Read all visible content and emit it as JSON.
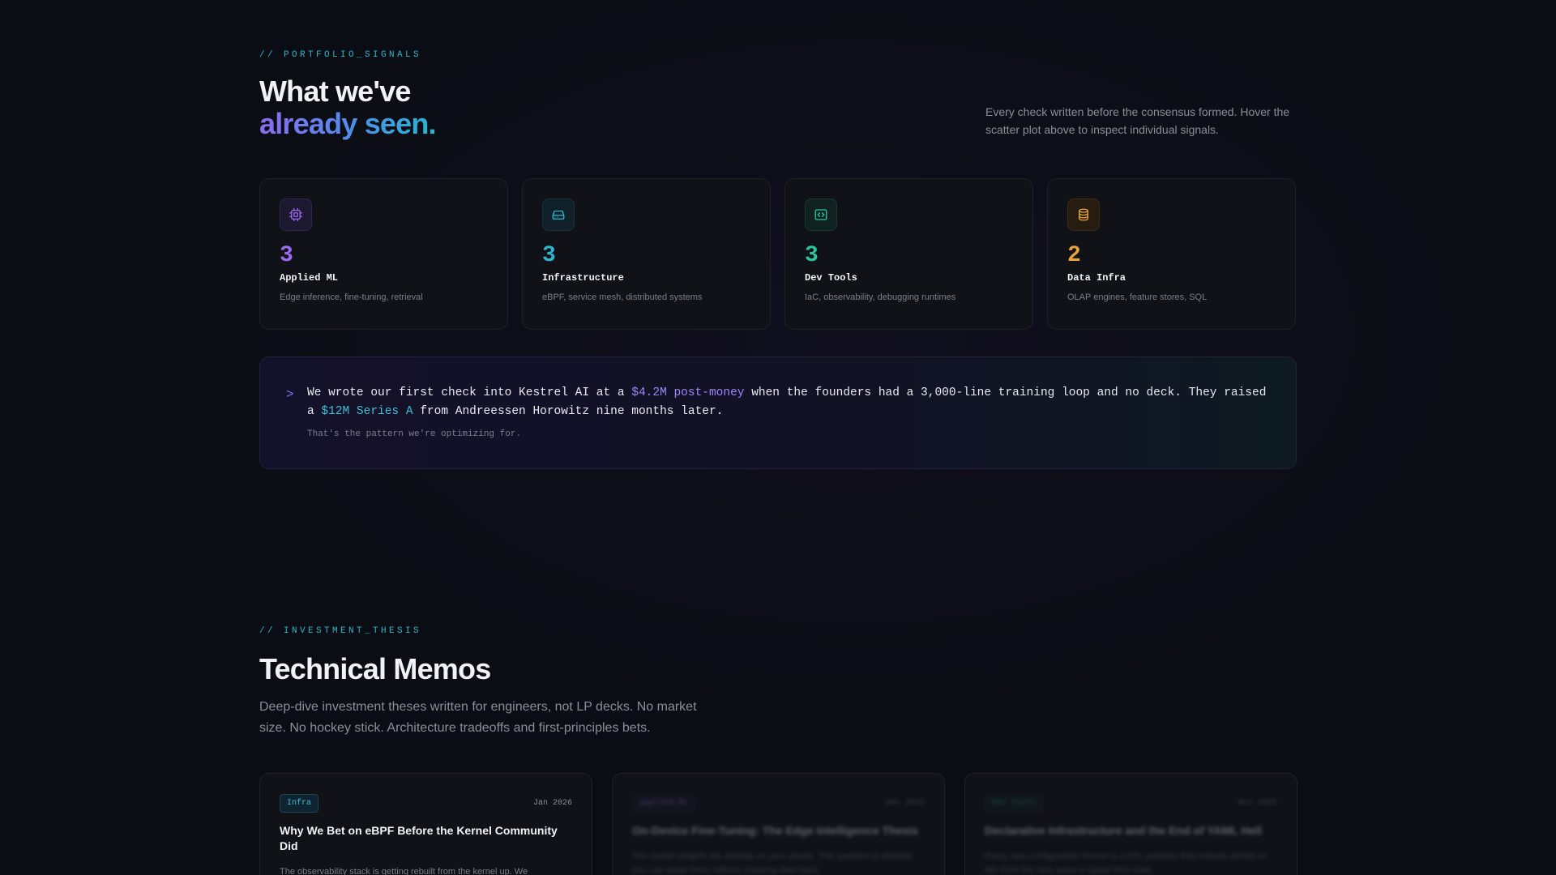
{
  "portfolio": {
    "eyebrow": "// PORTFOLIO_SIGNALS",
    "title_line1": "What we've",
    "title_line2": "already seen.",
    "side_note": "Every check written before the consensus formed. Hover the scatter plot above to inspect individual signals.",
    "stats": [
      {
        "icon": "cpu-chip-icon",
        "count": "3",
        "title": "Applied ML",
        "desc": "Edge inference, fine-tuning, retrieval",
        "color": "#9b6bf2",
        "bg": "#1c1830",
        "border": "#2e2650"
      },
      {
        "icon": "hard-drive-icon",
        "count": "3",
        "title": "Infrastructure",
        "desc": "eBPF, service mesh, distributed systems",
        "color": "#2fb6cf",
        "bg": "#0f2029",
        "border": "#173340"
      },
      {
        "icon": "code-brackets-icon",
        "count": "3",
        "title": "Dev Tools",
        "desc": "IaC, observability, debugging runtimes",
        "color": "#2fc4a0",
        "bg": "#0f2220",
        "border": "#173833"
      },
      {
        "icon": "database-icon",
        "count": "2",
        "title": "Data Infra",
        "desc": "OLAP engines, feature stores, SQL",
        "color": "#e8a23a",
        "bg": "#261c10",
        "border": "#3b2c16"
      }
    ],
    "quote": {
      "caret": ">",
      "part1": "We wrote our first check into Kestrel AI at a ",
      "highlight1": "$4.2M post-money",
      "part2": " when the founders had a 3,000-line training loop and no deck. They raised a ",
      "highlight2": "$12M Series A",
      "part3": " from Andreessen Horowitz nine months later.",
      "sub": "That's the pattern we're optimizing for."
    }
  },
  "memos_section": {
    "eyebrow": "// INVESTMENT_THESIS",
    "title": "Technical Memos",
    "subtitle": "Deep-dive investment theses written for engineers, not LP decks. No market size. No hockey stick. Architecture tradeoffs and first-principles bets.",
    "memos": [
      {
        "tag": "Infra",
        "date": "Jan 2026",
        "title": "Why We Bet on eBPF Before the Kernel Community Did",
        "excerpt": "The observability stack is getting rebuilt from the kernel up. We",
        "tag_color": "#3cc0d6",
        "tag_bg": "#0f2430",
        "tag_border": "#1d4452"
      },
      {
        "tag": "Applied ML",
        "date": "Dec 2025",
        "title": "On-Device Fine-Tuning: The Edge Intelligence Thesis",
        "excerpt": "The model weights are already on your phone. The question is whether you can adapt them without shipping data back.",
        "tag_color": "#9d85f5",
        "tag_bg": "#1c1830",
        "tag_border": "#2e2650"
      },
      {
        "tag": "Dev Tools",
        "date": "Nov 2025",
        "title": "Declarative Infrastructure and the End of YAML Hell",
        "excerpt": "Every new configuration format is a DSL problem that nobody admits to. We think the next wave is typed infra code.",
        "tag_color": "#2fc4a0",
        "tag_bg": "#0f2220",
        "tag_border": "#173833"
      }
    ]
  }
}
